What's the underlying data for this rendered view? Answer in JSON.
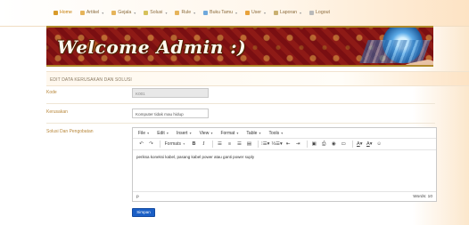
{
  "nav": {
    "items": [
      {
        "label": "Home",
        "color": "#d89a2a",
        "dropdown": false,
        "active": true
      },
      {
        "label": "Artikel",
        "color": "#e6b45a",
        "dropdown": true
      },
      {
        "label": "Gejala",
        "color": "#e6b45a",
        "dropdown": true
      },
      {
        "label": "Solusi",
        "color": "#d6c15a",
        "dropdown": true
      },
      {
        "label": "Rule",
        "color": "#e6b45a",
        "dropdown": true
      },
      {
        "label": "Buku Tamu",
        "color": "#6fa8dc",
        "dropdown": true
      },
      {
        "label": "User",
        "color": "#e8a23a",
        "dropdown": true
      },
      {
        "label": "Laporan",
        "color": "#c9b070",
        "dropdown": true
      },
      {
        "label": "Logout",
        "color": "#b9b9b9",
        "dropdown": false
      }
    ]
  },
  "banner": {
    "title": "Welcome Admin :)"
  },
  "section": {
    "title": "EDIT DATA KERUSAKAN DAN SOLUSI"
  },
  "form": {
    "kode": {
      "label": "Kode",
      "value": "K001"
    },
    "kerusakan": {
      "label": "Kerusakan",
      "value": "Komputer tidak mau hidup"
    },
    "solusi": {
      "label": "Solusi Dan Pengobatan"
    }
  },
  "editor": {
    "menus": [
      "File",
      "Edit",
      "Insert",
      "View",
      "Format",
      "Table",
      "Tools"
    ],
    "formats_label": "Formats",
    "content": "periksa koneksi kabel, pasang kabel power atau ganti power suply",
    "path": "p",
    "word_count": "Words: 10"
  },
  "submit": {
    "label": "Simpan"
  }
}
